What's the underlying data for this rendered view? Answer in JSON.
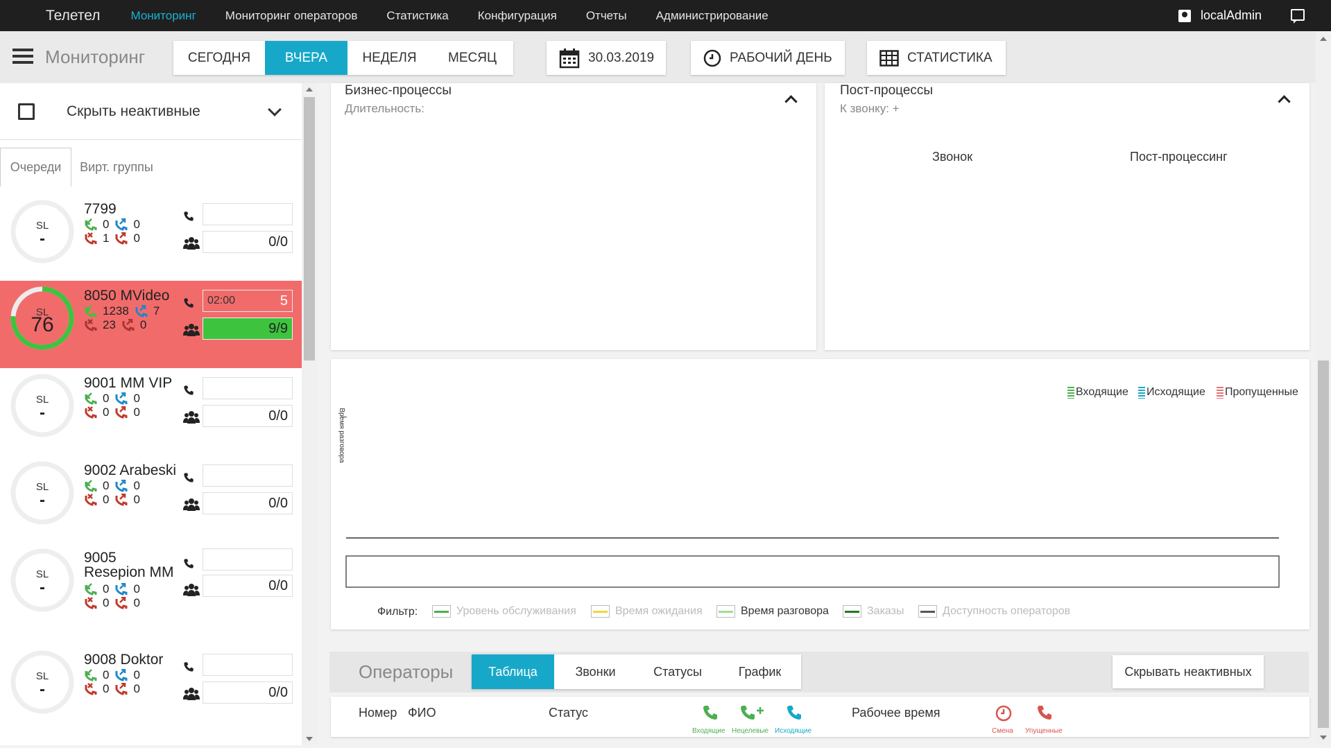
{
  "nav": {
    "brand": "Телетел",
    "items": [
      "Мониторинг",
      "Мониторинг операторов",
      "Статистика",
      "Конфигурация",
      "Отчеты",
      "Администрирование"
    ],
    "user": "localAdmin"
  },
  "toolbar": {
    "title": "Мониторинг",
    "periods": [
      "СЕГОДНЯ",
      "ВЧЕРА",
      "НЕДЕЛЯ",
      "МЕСЯЦ"
    ],
    "active_period": "ВЧЕРА",
    "date": "30.03.2019",
    "workday": "РАБОЧИЙ ДЕНЬ",
    "stats": "СТАТИСТИКА"
  },
  "left": {
    "hide_inactive": "Скрыть неактивные",
    "tabs": [
      "Очереди",
      "Вирт. группы"
    ],
    "queues": [
      {
        "name": "7799",
        "sl": "-",
        "in": "0",
        "out": "0",
        "missed": "1",
        "back": "0",
        "timer": "",
        "calls": "",
        "ops": "0/0"
      },
      {
        "name": "8050 MVideo",
        "sl": "76",
        "in": "1238",
        "out": "7",
        "missed": "23",
        "back": "0",
        "timer": "02:00",
        "calls": "5",
        "ops": "9/9"
      },
      {
        "name": "9001 MM VIP",
        "sl": "-",
        "in": "0",
        "out": "0",
        "missed": "0",
        "back": "0",
        "timer": "",
        "calls": "",
        "ops": "0/0"
      },
      {
        "name": "9002 Arabeski",
        "sl": "-",
        "in": "0",
        "out": "0",
        "missed": "0",
        "back": "0",
        "timer": "",
        "calls": "",
        "ops": "0/0"
      },
      {
        "name": "9005 Resepion MM",
        "sl": "-",
        "in": "0",
        "out": "0",
        "missed": "0",
        "back": "0",
        "timer": "",
        "calls": "",
        "ops": "0/0"
      },
      {
        "name": "9008 Doktor",
        "sl": "-",
        "in": "0",
        "out": "0",
        "missed": "0",
        "back": "0",
        "timer": "",
        "calls": "",
        "ops": "0/0"
      }
    ],
    "sl_label": "SL"
  },
  "business": {
    "title": "Бизнес-процессы",
    "subtitle": "Длительность:"
  },
  "post": {
    "title": "Пост-процессы",
    "subtitle": "К звонку: +",
    "col1": "Звонок",
    "col2": "Пост-процессинг"
  },
  "chart": {
    "ylabel": "Время разговора",
    "dash": "–",
    "legend": [
      {
        "label": "Входящие",
        "color": "#4caf50"
      },
      {
        "label": "Исходящие",
        "color": "#17a8c9"
      },
      {
        "label": "Пропущенные",
        "color": "#e57373"
      }
    ],
    "filter_label": "Фильтр:",
    "filters": [
      {
        "label": "Уровень обслуживания",
        "color": "#4caf50",
        "active": false
      },
      {
        "label": "Время ожидания",
        "color": "#f2d43a",
        "active": false
      },
      {
        "label": "Время разговора",
        "color": "#9ede8f",
        "active": true
      },
      {
        "label": "Заказы",
        "color": "#1f7a1f",
        "active": false
      },
      {
        "label": "Доступность операторов",
        "color": "#555555",
        "active": false
      }
    ]
  },
  "chart_data": {
    "type": "line",
    "ylabel": "Время разговора",
    "series": [],
    "x": []
  },
  "operators": {
    "title": "Операторы",
    "tabs": [
      "Таблица",
      "Звонки",
      "Статусы",
      "График"
    ],
    "active_tab": "Таблица",
    "hide_inactive": "Скрывать неактивных",
    "columns": {
      "number": "Номер",
      "name": "ФИО",
      "status": "Статус",
      "worktime": "Рабочее время"
    },
    "icon_labels": {
      "incoming": "Входящие",
      "nontarget": "Нецелевые",
      "outgoing": "Исходящие",
      "shift": "Смена",
      "missed": "Упущенные"
    }
  },
  "colors": {
    "accent": "#17a8c9",
    "alert": "#f26b6b",
    "ok": "#3ec33e",
    "in": "#4caf50",
    "out": "#1e88c7",
    "missed": "#c0392b"
  }
}
